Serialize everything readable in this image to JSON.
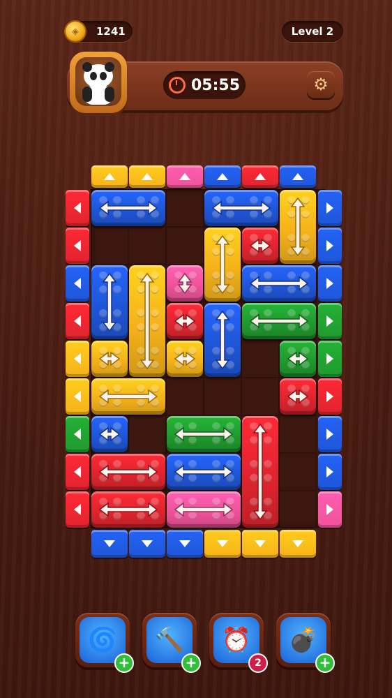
{
  "hud": {
    "coins": "1241",
    "level": "Level 2",
    "timer": "05:55",
    "settings_icon": "gear-icon",
    "avatar": "panda-avatar"
  },
  "colors": {
    "red": "#e0242e",
    "blue": "#1f56d8",
    "yellow": "#f5b21a",
    "pink": "#f0529a",
    "green": "#1f9a2e"
  },
  "board": {
    "rows": 9,
    "cols": 6,
    "top_gates": [
      "yellow",
      "yellow",
      "pink",
      "blue",
      "red",
      "blue"
    ],
    "bottom_gates": [
      "blue",
      "blue",
      "blue",
      "yellow",
      "yellow",
      "yellow"
    ],
    "left_gates": [
      "red",
      "red",
      "blue",
      "red",
      "yellow",
      "yellow",
      "green",
      "red",
      "red"
    ],
    "right_gates": [
      "blue",
      "blue",
      "blue",
      "green",
      "green",
      "red",
      "blue",
      "blue",
      "pink"
    ],
    "blocks": [
      {
        "color": "blue",
        "row": 0,
        "col": 0,
        "w": 2,
        "h": 1,
        "dir": "h"
      },
      {
        "color": "blue",
        "row": 0,
        "col": 3,
        "w": 2,
        "h": 1,
        "dir": "h"
      },
      {
        "color": "yellow",
        "row": 0,
        "col": 5,
        "w": 1,
        "h": 2,
        "dir": "v"
      },
      {
        "color": "red",
        "row": 1,
        "col": 4,
        "w": 1,
        "h": 1,
        "dir": "h"
      },
      {
        "color": "yellow",
        "row": 1,
        "col": 3,
        "w": 1,
        "h": 2,
        "dir": "v"
      },
      {
        "color": "blue",
        "row": 2,
        "col": 0,
        "w": 1,
        "h": 2,
        "dir": "v"
      },
      {
        "color": "yellow",
        "row": 2,
        "col": 1,
        "w": 1,
        "h": 3,
        "dir": "v"
      },
      {
        "color": "pink",
        "row": 2,
        "col": 2,
        "w": 1,
        "h": 1,
        "dir": "v"
      },
      {
        "color": "blue",
        "row": 2,
        "col": 4,
        "w": 2,
        "h": 1,
        "dir": "h"
      },
      {
        "color": "red",
        "row": 3,
        "col": 2,
        "w": 1,
        "h": 1,
        "dir": "h"
      },
      {
        "color": "blue",
        "row": 3,
        "col": 3,
        "w": 1,
        "h": 2,
        "dir": "v"
      },
      {
        "color": "green",
        "row": 3,
        "col": 4,
        "w": 2,
        "h": 1,
        "dir": "h"
      },
      {
        "color": "yellow",
        "row": 4,
        "col": 0,
        "w": 1,
        "h": 1,
        "dir": "h"
      },
      {
        "color": "yellow",
        "row": 4,
        "col": 2,
        "w": 1,
        "h": 1,
        "dir": "h"
      },
      {
        "color": "green",
        "row": 4,
        "col": 5,
        "w": 1,
        "h": 1,
        "dir": "h"
      },
      {
        "color": "yellow",
        "row": 5,
        "col": 0,
        "w": 2,
        "h": 1,
        "dir": "h"
      },
      {
        "color": "red",
        "row": 5,
        "col": 5,
        "w": 1,
        "h": 1,
        "dir": "h"
      },
      {
        "color": "blue",
        "row": 6,
        "col": 0,
        "w": 1,
        "h": 1,
        "dir": "h"
      },
      {
        "color": "green",
        "row": 6,
        "col": 2,
        "w": 2,
        "h": 1,
        "dir": "h"
      },
      {
        "color": "red",
        "row": 6,
        "col": 4,
        "w": 1,
        "h": 3,
        "dir": "v"
      },
      {
        "color": "red",
        "row": 7,
        "col": 0,
        "w": 2,
        "h": 1,
        "dir": "h"
      },
      {
        "color": "blue",
        "row": 7,
        "col": 2,
        "w": 2,
        "h": 1,
        "dir": "h"
      },
      {
        "color": "red",
        "row": 8,
        "col": 0,
        "w": 2,
        "h": 1,
        "dir": "h"
      },
      {
        "color": "pink",
        "row": 8,
        "col": 2,
        "w": 2,
        "h": 1,
        "dir": "h"
      }
    ]
  },
  "tools": [
    {
      "name": "drill",
      "icon": "drill-icon",
      "badge": "+"
    },
    {
      "name": "hammer",
      "icon": "hammer-icon",
      "badge": "+"
    },
    {
      "name": "clock-freeze",
      "icon": "alarm-clock-icon",
      "badge": "2"
    },
    {
      "name": "cannon",
      "icon": "cannon-icon",
      "badge": "+"
    }
  ]
}
